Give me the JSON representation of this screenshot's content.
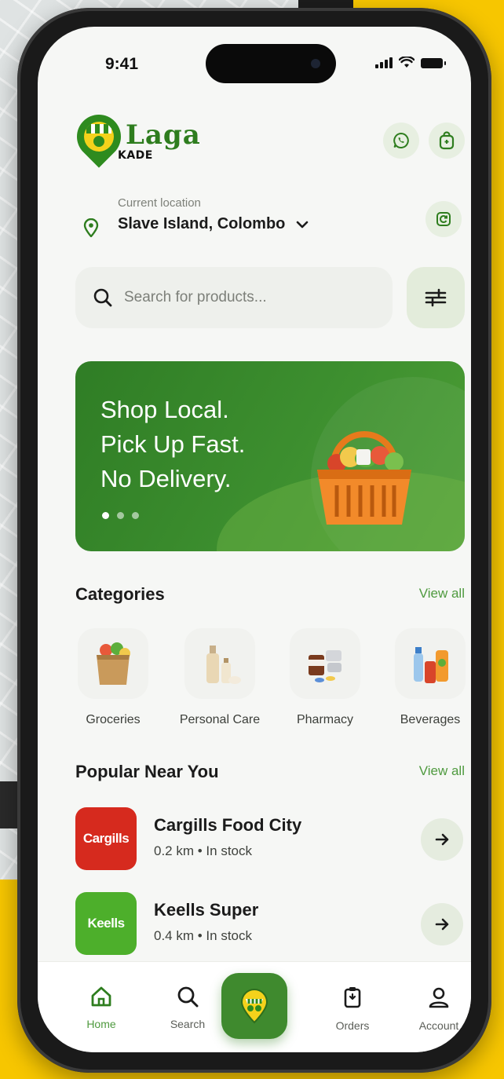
{
  "status": {
    "time": "9:41"
  },
  "brand": {
    "name": "Laga",
    "sub": "KADE"
  },
  "location": {
    "label": "Current location",
    "value": "Slave Island, Colombo"
  },
  "search": {
    "placeholder": "Search for products..."
  },
  "banner": {
    "lines": [
      "Shop Local.",
      "Pick Up Fast.",
      "No Delivery."
    ],
    "slide_count": 3,
    "active_slide": 1
  },
  "categories": {
    "title": "Categories",
    "view_all": "View all",
    "items": [
      {
        "label": "Groceries",
        "icon": "grocery-bag-icon"
      },
      {
        "label": "Personal Care",
        "icon": "personal-care-icon"
      },
      {
        "label": "Pharmacy",
        "icon": "pharmacy-icon"
      },
      {
        "label": "Beverages",
        "icon": "beverages-icon"
      }
    ]
  },
  "popular": {
    "title": "Popular Near You",
    "view_all": "View all",
    "stores": [
      {
        "logo_text": "Cargills",
        "name": "Cargills Food City",
        "meta": "0.2 km • In stock",
        "logo_color": "#D62A1E"
      },
      {
        "logo_text": "Keells",
        "name": "Keells Super",
        "meta": "0.4 km • In stock",
        "logo_color": "#4DAF2B"
      }
    ]
  },
  "nav": {
    "home": "Home",
    "search": "Search",
    "orders": "Orders",
    "account": "Account",
    "active": "home"
  },
  "colors": {
    "brand_green": "#3F8A2E",
    "accent_green": "#4F9A3F",
    "background_yellow": "#F7C600"
  }
}
